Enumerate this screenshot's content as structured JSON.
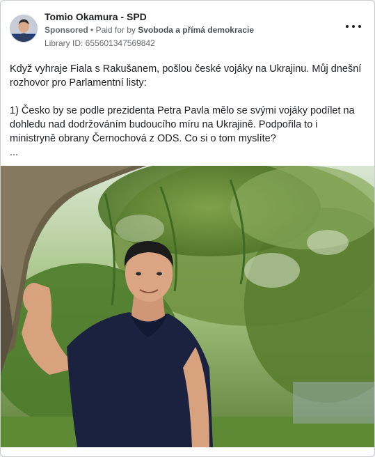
{
  "post": {
    "author": "Tomio Okamura - SPD",
    "sponsored_label": "Sponsored",
    "paid_for_prefix": "Paid for by",
    "payer": "Svoboda a přímá demokracie",
    "library_id": "Library ID: 655601347569842",
    "text_line1": "Když vyhraje Fiala s Rakušanem, pošlou české vojáky na Ukrajinu. Můj dnešní rozhovor pro Parlamentní listy:",
    "text_line2": "1) Česko by se podle prezidenta Petra Pavla mělo se svými vojáky podílet na dohledu nad dodržováním budoucího míru na Ukrajině. Podpořila to i ministryně obrany Černochová z ODS. Co si o tom myslíte?",
    "ellipsis": "...",
    "more_icon": "more-horizontal-icon",
    "image": "man-in-navy-polo-under-willow-tree"
  },
  "colors": {
    "text": "#1c1e21",
    "secondary": "#65676b",
    "card_border": "#c9ccd1"
  }
}
